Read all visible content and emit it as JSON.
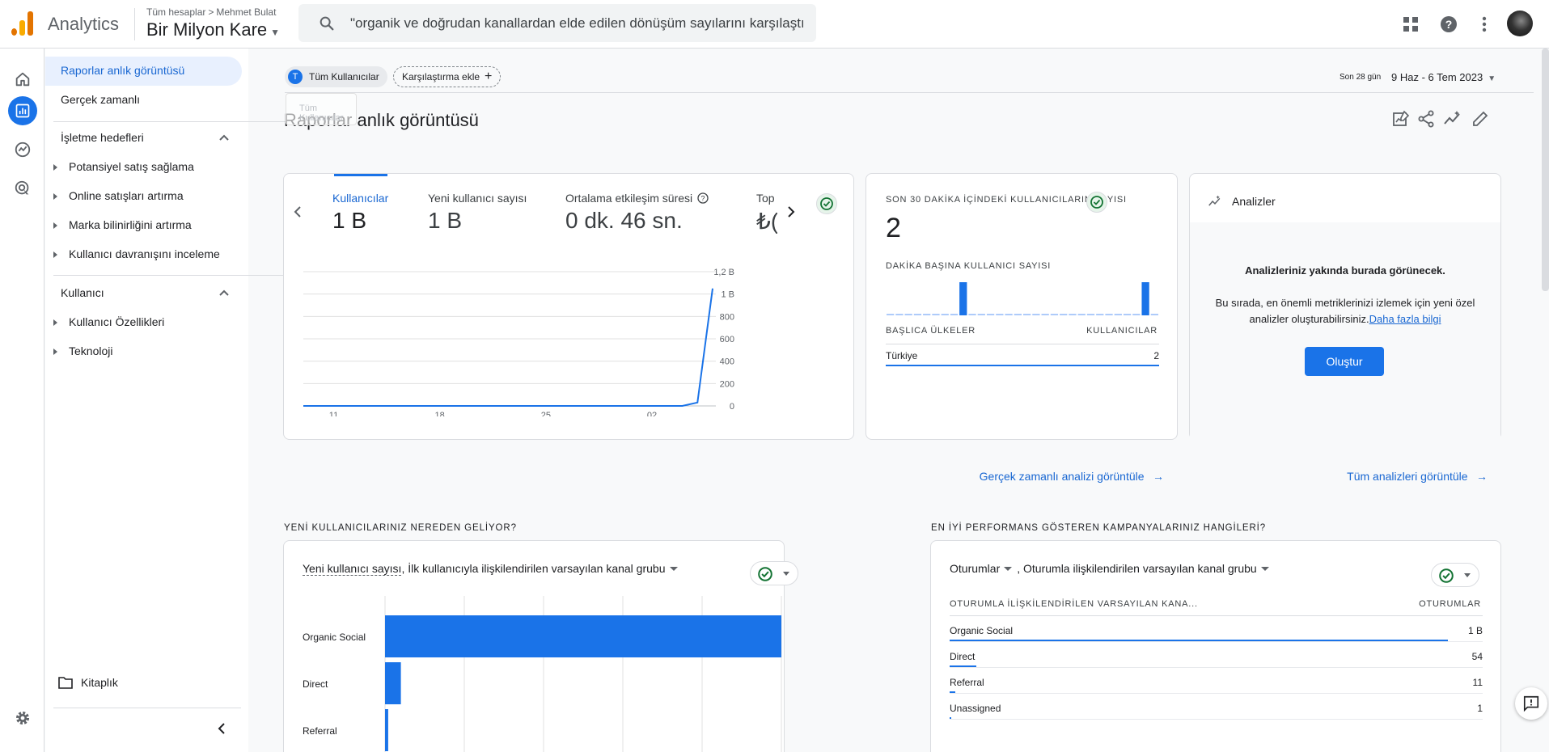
{
  "app": {
    "name": "Analytics"
  },
  "breadcrumb": {
    "all_accounts": "Tüm hesaplar",
    "separator": ">",
    "account": "Mehmet Bulat"
  },
  "property": {
    "name": "Bir Milyon Kare"
  },
  "search": {
    "query": "\"organik ve doğrudan kanallardan elde edilen dönüşüm sayılarını karşılaştı..."
  },
  "sidebar": {
    "items": [
      {
        "label": "Raporlar anlık görüntüsü",
        "active": true
      },
      {
        "label": "Gerçek zamanlı"
      }
    ],
    "sections": [
      {
        "title": "İşletme hedefleri",
        "items": [
          "Potansiyel satış sağlama",
          "Online satışları artırma",
          "Marka bilinirliğini artırma",
          "Kullanıcı davranışını inceleme"
        ]
      },
      {
        "title": "Kullanıcı",
        "items": [
          "Kullanıcı Özellikleri",
          "Teknoloji"
        ]
      }
    ],
    "library": "Kitaplık"
  },
  "filters": {
    "segment_letter": "T",
    "segment": "Tüm Kullanıcılar",
    "add_comparison": "Karşılaştırma ekle",
    "ghost": "Tüm Kullanıcılar"
  },
  "date": {
    "label": "Son 28 gün",
    "range": "9 Haz - 6 Tem 2023"
  },
  "page": {
    "title": "Raporlar anlık görüntüsü"
  },
  "overview": {
    "metrics": [
      {
        "label": "Kullanıcılar",
        "value": "1 B",
        "selected": true
      },
      {
        "label": "Yeni kullanıcı sayısı",
        "value": "1 B"
      },
      {
        "label": "Ortalama etkileşim süresi",
        "value": "0 dk. 46 sn."
      },
      {
        "label": "Top",
        "value": "₺("
      }
    ],
    "chart_data": {
      "type": "line",
      "x": [
        "9 Haz",
        "10",
        "11",
        "12",
        "13",
        "14",
        "15",
        "16",
        "17",
        "18",
        "19",
        "20",
        "21",
        "22",
        "23",
        "24",
        "25",
        "26",
        "27",
        "28",
        "29",
        "30",
        "01",
        "02",
        "03",
        "04",
        "05",
        "06"
      ],
      "series": [
        {
          "values": [
            0,
            0,
            0,
            0,
            0,
            0,
            0,
            0,
            0,
            0,
            0,
            0,
            0,
            0,
            0,
            0,
            0,
            0,
            0,
            0,
            0,
            0,
            0,
            0,
            0,
            0,
            30,
            1050
          ]
        }
      ],
      "x_ticks": [
        {
          "top": "11",
          "bottom": "Haz"
        },
        {
          "top": "18",
          "bottom": ""
        },
        {
          "top": "25",
          "bottom": ""
        },
        {
          "top": "02",
          "bottom": "Tem"
        }
      ],
      "y_ticks": [
        "1,2 B",
        "1 B",
        "800",
        "600",
        "400",
        "200",
        "0"
      ],
      "ylim": [
        0,
        1200
      ],
      "grid": true,
      "color": "#1a73e8"
    }
  },
  "realtime": {
    "title": "SON 30 DAKİKA İÇİNDEKİ KULLANICILARIN SAYISI",
    "value": "2",
    "per_minute_label": "DAKİKA BAŞINA KULLANICI SAYISI",
    "chart_data": {
      "type": "bar",
      "values": [
        0,
        0,
        0,
        0,
        0,
        0,
        0,
        0,
        1,
        0,
        0,
        0,
        0,
        0,
        0,
        0,
        0,
        0,
        0,
        0,
        0,
        0,
        0,
        0,
        0,
        0,
        0,
        0,
        1,
        0
      ],
      "color": "#1a73e8"
    },
    "table": {
      "col1": "BAŞLICA ÜLKELER",
      "col2": "KULLANICILAR",
      "rows": [
        {
          "label": "Türkiye",
          "value": "2"
        }
      ]
    },
    "link": "Gerçek zamanlı analizi görüntüle"
  },
  "insights": {
    "title": "Analizler",
    "heading": "Analizleriniz yakında burada görünecek.",
    "body": "Bu sırada, en önemli metriklerinizi izlemek için yeni özel analizler oluşturabilirsiniz.",
    "learn_more": "Daha fazla bilgi",
    "button": "Oluştur",
    "link": "Tüm analizleri görüntüle"
  },
  "acquisition": {
    "section_title": "YENİ KULLANICILARINIZ NEREDEN GELİYOR?",
    "metric": "Yeni kullanıcı sayısı",
    "dimension": ", İlk kullanıcıyla ilişkilendirilen varsayılan kanal grubu",
    "chart_data": {
      "type": "bar",
      "orientation": "horizontal",
      "categories": [
        "Organic Social",
        "Direct",
        "Referral"
      ],
      "values": [
        1000,
        40,
        8
      ],
      "xlim": [
        0,
        1000
      ],
      "color": "#1a73e8"
    }
  },
  "campaigns": {
    "section_title": "EN İYİ PERFORMANS GÖSTEREN KAMPANYALARINIZ HANGİLERİ?",
    "metric": "Oturumlar",
    "dimension": ", Oturumla ilişkilendirilen varsayılan kanal grubu",
    "col1": "OTURUMLA İLİŞKİLENDİRİLEN VARSAYILAN KANA...",
    "col2": "OTURUMLAR",
    "rows": [
      {
        "label": "Organic Social",
        "value": "1 B",
        "share": 1.0
      },
      {
        "label": "Direct",
        "value": "54",
        "share": 0.054
      },
      {
        "label": "Referral",
        "value": "11",
        "share": 0.011
      },
      {
        "label": "Unassigned",
        "value": "1",
        "share": 0.001
      }
    ]
  }
}
